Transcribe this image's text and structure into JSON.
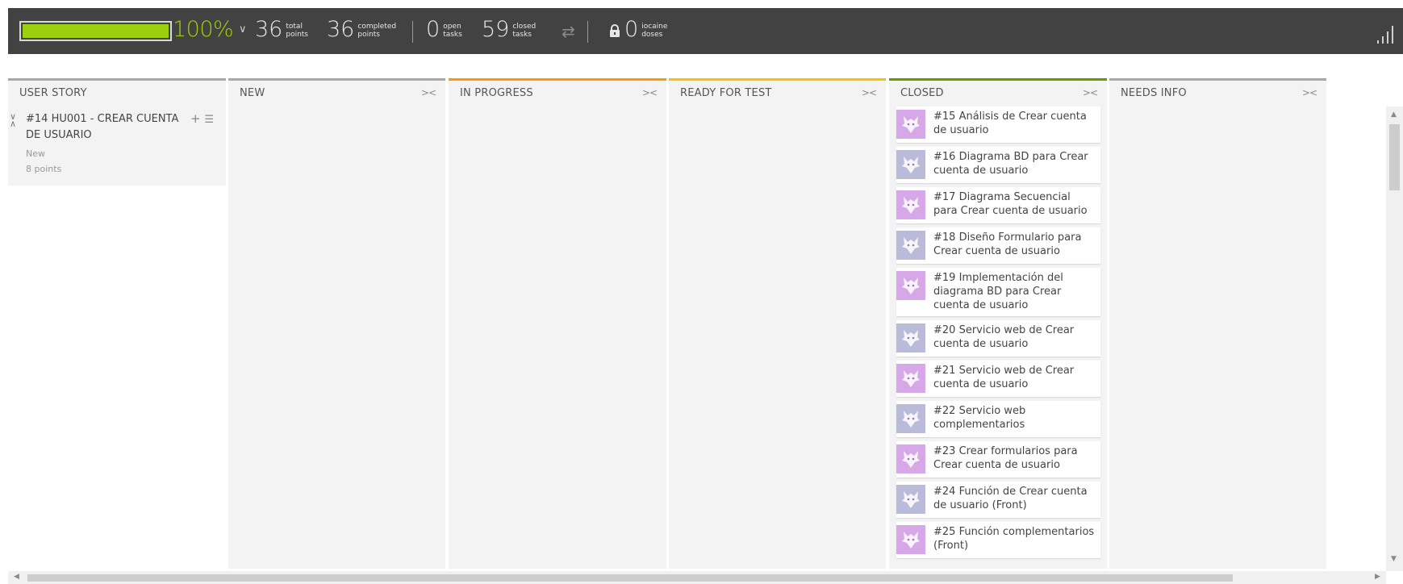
{
  "summary": {
    "percent": "100%",
    "progress_fraction": 1.0,
    "total_points": "36",
    "total_points_label_1": "total",
    "total_points_label_2": "points",
    "completed_points": "36",
    "completed_label_1": "completed",
    "completed_label_2": "points",
    "open_tasks": "0",
    "open_label_1": "open",
    "open_label_2": "tasks",
    "closed_tasks": "59",
    "closed_label_1": "closed",
    "closed_label_2": "tasks",
    "iocaine": "0",
    "iocaine_label_1": "iocaine",
    "iocaine_label_2": "doses"
  },
  "columns": {
    "user_story": "USER STORY",
    "new": "NEW",
    "in_progress": "IN PROGRESS",
    "ready_for_test": "READY FOR TEST",
    "closed": "CLOSED",
    "needs_info": "NEEDS INFO"
  },
  "column_colors": {
    "user_story": "#a8a8a8",
    "new": "#a8a8a8",
    "in_progress": "#ff9900",
    "ready_for_test": "#fcc000",
    "closed": "#669900",
    "needs_info": "#a8a8a8"
  },
  "story": {
    "title": "#14 HU001 - CREAR CUENTA DE USUARIO",
    "status": "New",
    "points": "8 points"
  },
  "icons": {
    "fold": "fold-icon",
    "add": "plus-icon",
    "list": "list-icon",
    "swap": "swap-arrows-icon",
    "lock": "lock-icon",
    "signal": "signal-bars-icon"
  },
  "tasks": [
    {
      "text": "#15 Análisis de Crear cuenta de usuario",
      "avatar": "a1"
    },
    {
      "text": "#16 Diagrama BD para Crear cuenta de usuario",
      "avatar": "a2"
    },
    {
      "text": "#17 Diagrama Secuencial para Crear cuenta de usuario",
      "avatar": "a1"
    },
    {
      "text": "#18 Diseño Formulario para Crear cuenta de usuario",
      "avatar": "a2"
    },
    {
      "text": "#19 Implementación del diagrama BD para Crear cuenta de usuario",
      "avatar": "a1"
    },
    {
      "text": "#20 Servicio web de Crear cuenta de usuario",
      "avatar": "a2"
    },
    {
      "text": "#21 Servicio web de Crear cuenta de usuario",
      "avatar": "a1"
    },
    {
      "text": "#22 Servicio web complementarios",
      "avatar": "a2"
    },
    {
      "text": "#23 Crear formularios para Crear cuenta de usuario",
      "avatar": "a1"
    },
    {
      "text": "#24 Función de Crear cuenta de usuario (Front)",
      "avatar": "a2"
    },
    {
      "text": "#25 Función complementarios (Front)",
      "avatar": "a1"
    }
  ]
}
